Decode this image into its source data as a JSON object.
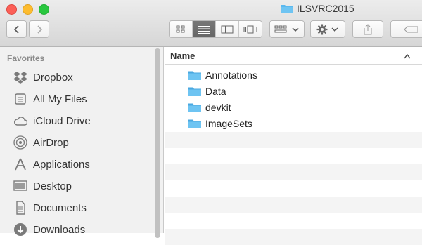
{
  "window": {
    "title": "ILSVRC2015"
  },
  "toolbar": {
    "back_icon": "chevron-left-icon",
    "forward_icon": "chevron-right-icon",
    "view_modes": [
      "icon-view",
      "list-view",
      "column-view",
      "cover-flow-view"
    ],
    "active_view": "list-view"
  },
  "sidebar": {
    "section_label": "Favorites",
    "items": [
      {
        "label": "Dropbox",
        "icon": "dropbox-icon"
      },
      {
        "label": "All My Files",
        "icon": "all-files-icon"
      },
      {
        "label": "iCloud Drive",
        "icon": "cloud-icon"
      },
      {
        "label": "AirDrop",
        "icon": "airdrop-icon"
      },
      {
        "label": "Applications",
        "icon": "applications-icon"
      },
      {
        "label": "Desktop",
        "icon": "desktop-icon"
      },
      {
        "label": "Documents",
        "icon": "documents-icon"
      },
      {
        "label": "Downloads",
        "icon": "downloads-icon"
      }
    ]
  },
  "file_list": {
    "column_header": "Name",
    "rows": [
      {
        "name": "Annotations",
        "type": "folder"
      },
      {
        "name": "Data",
        "type": "folder"
      },
      {
        "name": "devkit",
        "type": "folder"
      },
      {
        "name": "ImageSets",
        "type": "folder"
      }
    ]
  },
  "colors": {
    "folder": "#5bb8ee",
    "selected_segment": "#6d6d6d"
  }
}
